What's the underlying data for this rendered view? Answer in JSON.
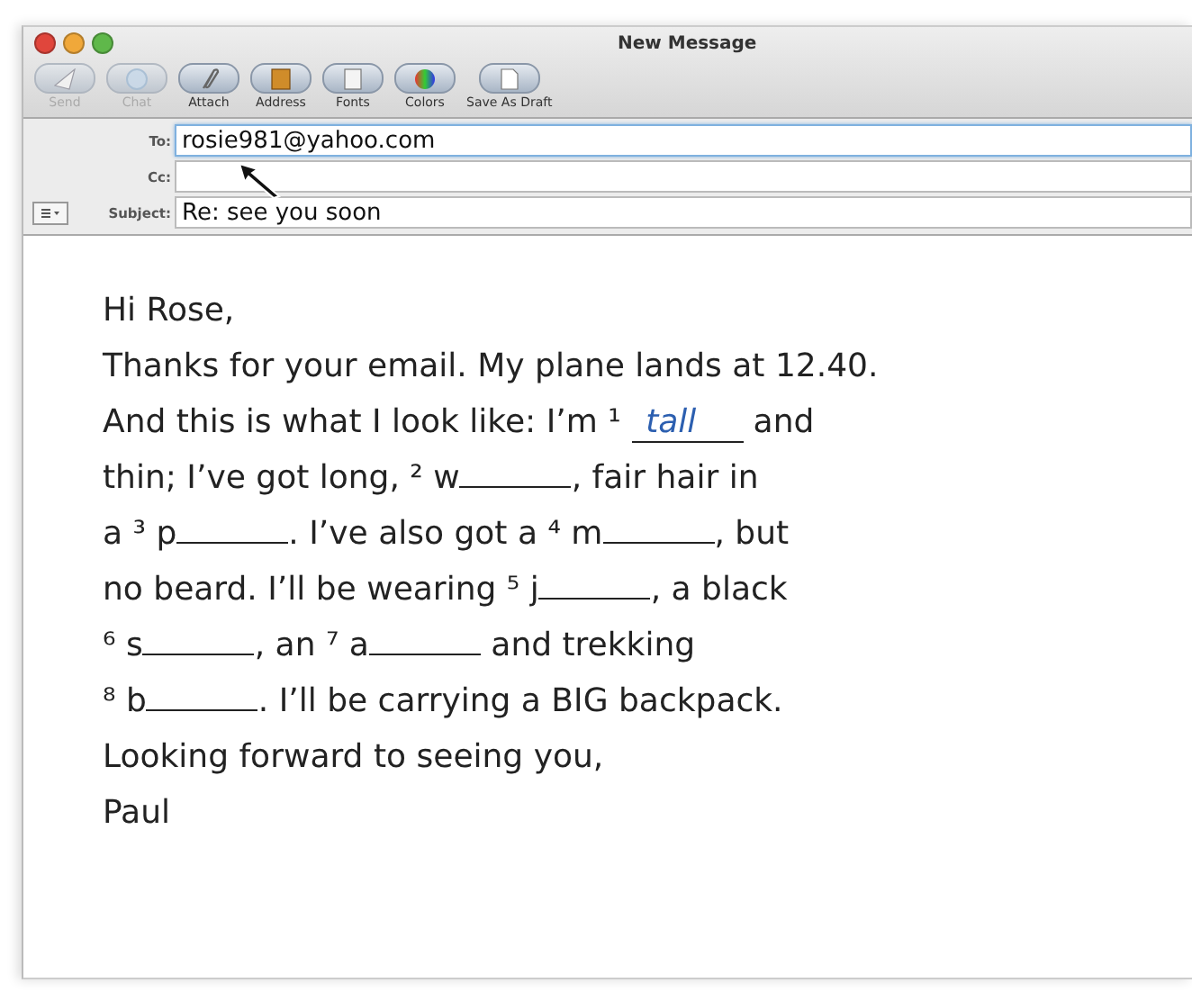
{
  "window": {
    "title": "New Message"
  },
  "toolbar": [
    {
      "label": "Send",
      "disabled": true
    },
    {
      "label": "Chat",
      "disabled": true
    },
    {
      "label": "Attach",
      "disabled": false
    },
    {
      "label": "Address",
      "disabled": false
    },
    {
      "label": "Fonts",
      "disabled": false
    },
    {
      "label": "Colors",
      "disabled": false
    },
    {
      "label": "Save As Draft",
      "disabled": false
    }
  ],
  "fields": {
    "to": {
      "label": "To:",
      "value": "rosie981@yahoo.com"
    },
    "cc": {
      "label": "Cc:"
    },
    "subject": {
      "label": "Subject:",
      "value": "Re: see you soon"
    }
  },
  "body": [
    [
      {
        "kind": "text",
        "text": "Hi Rose,"
      }
    ],
    [
      {
        "kind": "text",
        "text": "Thanks for your email. My plane lands at 12.40."
      }
    ],
    [
      {
        "kind": "text",
        "text": "And this is what I look like: I’m "
      },
      {
        "kind": "gap",
        "number": "¹",
        "answer": "tall"
      },
      {
        "kind": "text",
        "text": " and"
      }
    ],
    [
      {
        "kind": "text",
        "text": "thin; I’ve got long, "
      },
      {
        "kind": "gap",
        "number": "²",
        "start": "w"
      },
      {
        "kind": "text",
        "text": ", fair hair in"
      }
    ],
    [
      {
        "kind": "text",
        "text": "a "
      },
      {
        "kind": "gap",
        "number": "³",
        "start": "p"
      },
      {
        "kind": "text",
        "text": ". I’ve also got a "
      },
      {
        "kind": "gap",
        "number": "⁴",
        "start": "m"
      },
      {
        "kind": "text",
        "text": ", but"
      }
    ],
    [
      {
        "kind": "text",
        "text": "no beard. I’ll be wearing "
      },
      {
        "kind": "gap",
        "number": "⁵",
        "start": "j"
      },
      {
        "kind": "text",
        "text": ", a black"
      }
    ],
    [
      {
        "kind": "gap",
        "number": "⁶",
        "start": "s"
      },
      {
        "kind": "text",
        "text": ", an "
      },
      {
        "kind": "gap",
        "number": "⁷",
        "start": "a"
      },
      {
        "kind": "text",
        "text": " and trekking"
      }
    ],
    [
      {
        "kind": "gap",
        "number": "⁸",
        "start": "b"
      },
      {
        "kind": "text",
        "text": ". I’ll be carrying a BIG backpack."
      }
    ],
    [
      {
        "kind": "text",
        "text": "Looking forward to seeing you,"
      }
    ],
    [
      {
        "kind": "text",
        "text": "Paul"
      }
    ]
  ]
}
